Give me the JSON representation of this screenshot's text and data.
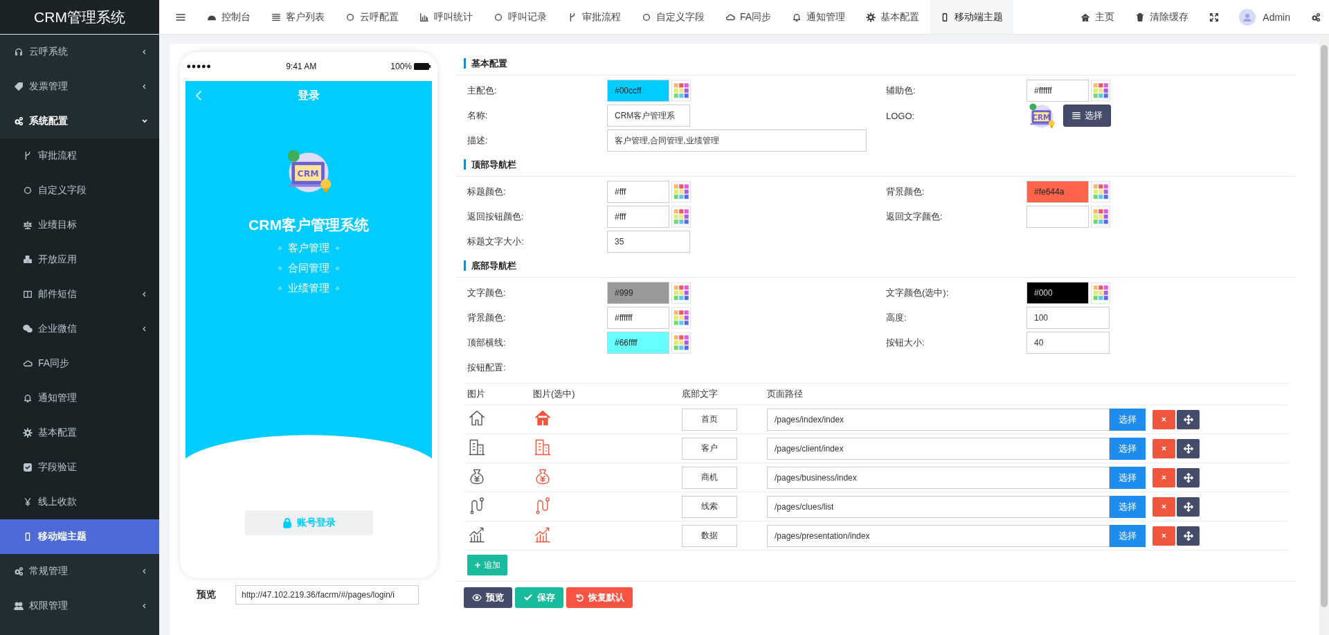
{
  "app_title": "CRM管理系统",
  "top_nav": {
    "items": [
      {
        "label": "控制台",
        "selected": false
      },
      {
        "label": "客户列表",
        "selected": false
      },
      {
        "label": "云呼配置",
        "selected": false
      },
      {
        "label": "呼叫统计",
        "selected": false
      },
      {
        "label": "呼叫记录",
        "selected": false
      },
      {
        "label": "审批流程",
        "selected": false
      },
      {
        "label": "自定义字段",
        "selected": false
      },
      {
        "label": "FA同步",
        "selected": false
      },
      {
        "label": "通知管理",
        "selected": false
      },
      {
        "label": "基本配置",
        "selected": false
      },
      {
        "label": "移动端主题",
        "selected": true
      }
    ],
    "links": [
      {
        "label": "主页"
      },
      {
        "label": "清除缓存"
      }
    ],
    "user": "Admin"
  },
  "sidebar": {
    "items": [
      {
        "label": "云呼系统",
        "selected": false,
        "expanded": false
      },
      {
        "label": "发票管理",
        "selected": false,
        "expanded": false
      },
      {
        "label": "系统配置",
        "selected": false,
        "expanded": true,
        "children": [
          {
            "label": "审批流程",
            "selected": false
          },
          {
            "label": "自定义字段",
            "selected": false
          },
          {
            "label": "业绩目标",
            "selected": false
          },
          {
            "label": "开放应用",
            "selected": false
          },
          {
            "label": "邮件短信",
            "selected": false,
            "expanded": false
          },
          {
            "label": "企业微信",
            "selected": false,
            "expanded": false
          },
          {
            "label": "FA同步",
            "selected": false
          },
          {
            "label": "通知管理",
            "selected": false
          },
          {
            "label": "基本配置",
            "selected": false
          },
          {
            "label": "字段验证",
            "selected": false
          },
          {
            "label": "线上收款",
            "selected": false
          },
          {
            "label": "移动端主题",
            "selected": true
          }
        ]
      },
      {
        "label": "常规管理",
        "selected": false,
        "expanded": false
      },
      {
        "label": "权限管理",
        "selected": false,
        "expanded": false
      }
    ]
  },
  "phone": {
    "time": "9:41 AM",
    "battery": "100%",
    "title": "登录",
    "logo_text": "CRM",
    "app_name": "CRM客户管理系统",
    "features": [
      "客户管理",
      "合同管理",
      "业绩管理"
    ],
    "login_button": "账号登录"
  },
  "preview": {
    "label": "预览",
    "url": "http://47.102.219.36/facrm/#/pages/login/i"
  },
  "sections": [
    {
      "title": "基本配置",
      "rows": [
        [
          {
            "label": "主配色:",
            "kind": "color",
            "value": "#00ccff"
          },
          {
            "label": "辅助色:",
            "kind": "color",
            "value": "#ffffff"
          }
        ],
        [
          {
            "label": "名称:",
            "kind": "text",
            "value": "CRM客户管理系"
          },
          {
            "label": "LOGO:",
            "kind": "logo",
            "logo_text": "CRM",
            "button": "选择"
          }
        ],
        [
          {
            "label": "描述:",
            "kind": "long_text",
            "value": "客户管理,合同管理,业绩管理"
          }
        ]
      ]
    },
    {
      "title": "顶部导航栏",
      "rows": [
        [
          {
            "label": "标题颜色:",
            "kind": "color",
            "value": "#fff"
          },
          {
            "label": "背景颜色:",
            "kind": "color",
            "value": "#fe644a"
          }
        ],
        [
          {
            "label": "返回按钮颜色:",
            "kind": "color",
            "value": "#fff"
          },
          {
            "label": "返回文字颜色:",
            "kind": "color"
          }
        ],
        [
          {
            "label": "标题文字大小:",
            "kind": "text",
            "value": "35"
          }
        ]
      ]
    },
    {
      "title": "底部导航栏",
      "rows": [
        [
          {
            "label": "文字颜色:",
            "kind": "color",
            "value": "#999"
          },
          {
            "label": "文字颜色(选中):",
            "kind": "color",
            "value": "#000"
          }
        ],
        [
          {
            "label": "背景颜色:",
            "kind": "color",
            "value": "#ffffff"
          },
          {
            "label": "高度:",
            "kind": "text",
            "value": "100"
          }
        ],
        [
          {
            "label": "顶部横线:",
            "kind": "color",
            "value": "#66ffff"
          },
          {
            "label": "按钮大小:",
            "kind": "text",
            "value": "40"
          }
        ]
      ]
    }
  ],
  "buttons_config": {
    "label": "按钮配置:",
    "columns": [
      "图片",
      "图片(选中)",
      "底部文字",
      "页面路径"
    ],
    "rows": [
      {
        "text": "首页",
        "path": "/pages/index/index",
        "select": "选择"
      },
      {
        "text": "客户",
        "path": "/pages/client/index",
        "select": "选择"
      },
      {
        "text": "商机",
        "path": "/pages/business/index",
        "select": "选择"
      },
      {
        "text": "线索",
        "path": "/pages/clues/list",
        "select": "选择"
      },
      {
        "text": "数据",
        "path": "/pages/presentation/index",
        "select": "选择"
      }
    ],
    "add_button": "追加"
  },
  "footer_buttons": [
    {
      "label": "预览",
      "kind": "preview"
    },
    {
      "label": "保存",
      "kind": "save"
    },
    {
      "label": "恢复默认",
      "kind": "reset"
    }
  ]
}
